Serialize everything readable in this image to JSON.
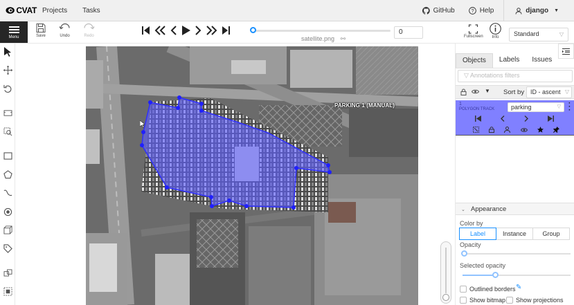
{
  "header": {
    "logo_text": "CVAT",
    "nav": [
      "Projects",
      "Tasks"
    ],
    "github": "GitHub",
    "help": "Help",
    "user": "django"
  },
  "toolbar": {
    "menu": "Menu",
    "save": "Save",
    "undo": "Undo",
    "redo": "Redo",
    "filename": "satellite.png",
    "frame": "0",
    "frame_progress": 0,
    "fullscreen": "Fullscreen",
    "info": "Info",
    "workspace": "Standard"
  },
  "canvas": {
    "object_label": "PARKING 1 (MANUAL)",
    "polygon_color": "#6060ff"
  },
  "sidebar": {
    "tabs": [
      "Objects",
      "Labels",
      "Issues"
    ],
    "active_tab": "Objects",
    "filter_placeholder": "Annotations filters",
    "sort_label": "Sort by",
    "sort_value": "ID - ascent",
    "objects": [
      {
        "id": "1",
        "type": "POLYGON TRACK",
        "label": "parking",
        "color": "#8080ff"
      }
    ]
  },
  "appearance": {
    "title": "Appearance",
    "color_by_label": "Color by",
    "color_by_options": [
      "Label",
      "Instance",
      "Group"
    ],
    "color_by_selected": "Label",
    "opacity_label": "Opacity",
    "opacity_value": 0,
    "selected_opacity_label": "Selected opacity",
    "selected_opacity_value": 0.3,
    "outlined_borders": "Outlined borders",
    "show_bitmap": "Show bitmap",
    "show_projections": "Show projections"
  }
}
